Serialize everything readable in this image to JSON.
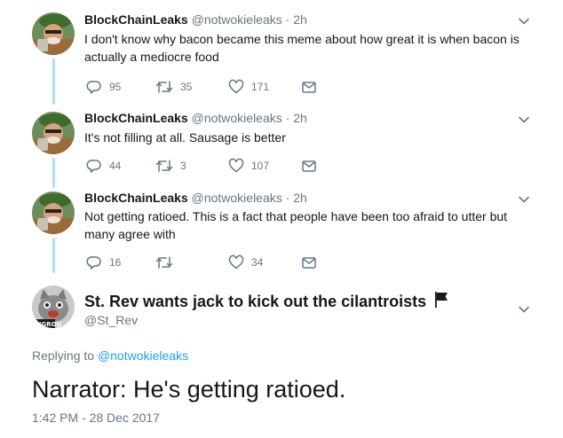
{
  "thread": [
    {
      "name": "BlockChainLeaks",
      "handle": "@notwokieleaks",
      "dot": "·",
      "time": "2h",
      "text": "I don't know why bacon became this meme about how great it is when bacon is actually a mediocre food",
      "replies": "95",
      "retweets": "35",
      "likes": "171"
    },
    {
      "name": "BlockChainLeaks",
      "handle": "@notwokieleaks",
      "dot": "·",
      "time": "2h",
      "text": "It's not filling at all.  Sausage is better",
      "replies": "44",
      "retweets": "3",
      "likes": "107"
    },
    {
      "name": "BlockChainLeaks",
      "handle": "@notwokieleaks",
      "dot": "·",
      "time": "2h",
      "text": "Not getting ratioed.  This is a fact that people have been too afraid to utter but many agree with",
      "replies": "16",
      "retweets": "",
      "likes": "34"
    }
  ],
  "main": {
    "name": "St. Rev wants jack to kick out the cilantroists",
    "handle": "@St_Rev",
    "avatar_label": "INGROU",
    "replying_prefix": "Replying to",
    "replying_to": "@notwokieleaks",
    "text": "Narrator: He's getting ratioed.",
    "timestamp": "1:42 PM - 28 Dec 2017"
  },
  "colors": {
    "thread_line": "#b4def7",
    "link": "#1da1f2",
    "muted": "#657786"
  }
}
